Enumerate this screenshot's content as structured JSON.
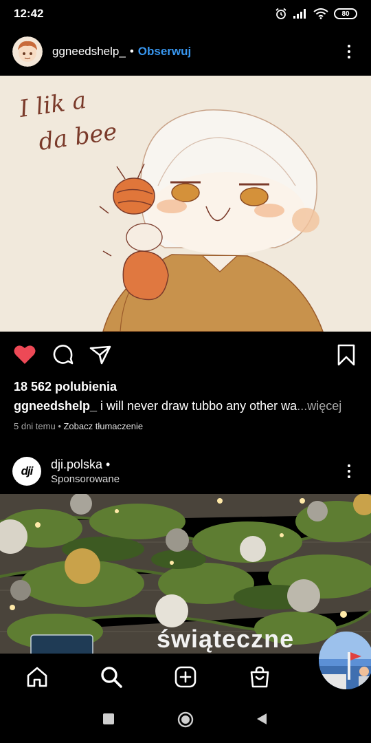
{
  "status_bar": {
    "time": "12:42",
    "battery": "80",
    "icons": [
      "alarm-icon",
      "signal-icon",
      "wifi-icon",
      "battery-icon"
    ]
  },
  "post": {
    "username": "ggneedshelp_",
    "separator": "•",
    "follow_label": "Obserwuj",
    "image_text_line1": "I lik a",
    "image_text_line2": "da bee",
    "liked": true,
    "likes_text": "18 562 polubienia",
    "caption_user": "ggneedshelp_",
    "caption_text": " i will never draw tubbo any other wa",
    "caption_more": "...więcej",
    "time_ago": "5 dni temu",
    "meta_separator": " • ",
    "translate_label": "Zobacz tłumaczenie"
  },
  "sponsored_post": {
    "username": "dji.polska •",
    "sponsor_label": "Sponsorowane",
    "logo_text": "dji",
    "ad_word": "świąteczne"
  },
  "bottom_nav": {
    "items": [
      "home-icon",
      "search-icon",
      "add-post-icon",
      "shop-icon",
      "profile-avatar"
    ]
  },
  "colors": {
    "accent": "#3897f0",
    "like": "#ed4956",
    "background": "#000000"
  }
}
